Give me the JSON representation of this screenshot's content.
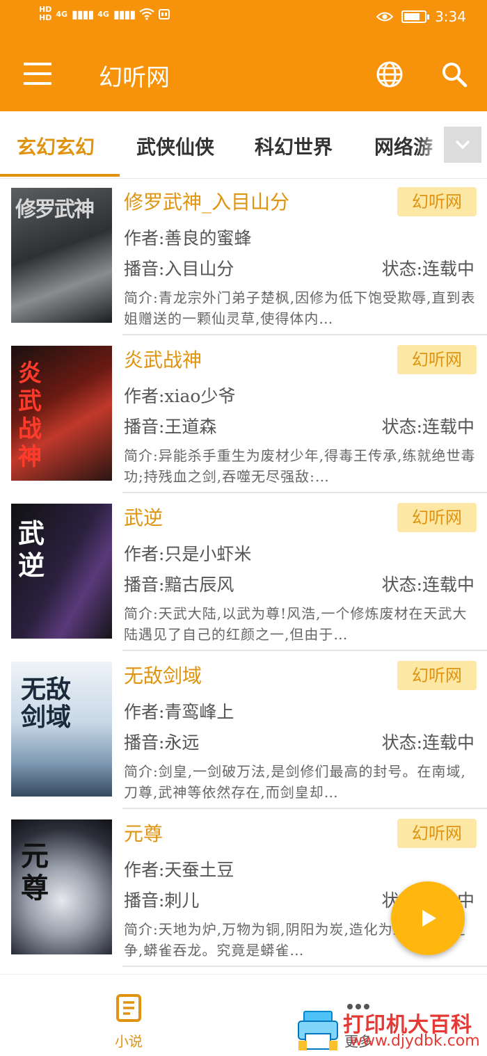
{
  "status_bar": {
    "hd_top": "HD",
    "hd_bottom": "HD",
    "net1": "4G",
    "net2": "4G",
    "time": "3:34"
  },
  "app_bar": {
    "title": "幻听网",
    "icons": [
      "menu-icon",
      "globe-icon",
      "search-icon"
    ]
  },
  "tabs": [
    {
      "label": "玄幻玄幻",
      "active": true
    },
    {
      "label": "武侠仙侠",
      "active": false
    },
    {
      "label": "科幻世界",
      "active": false
    },
    {
      "label": "网络游",
      "active": false
    }
  ],
  "books": [
    {
      "title": "修罗武神_入目山分",
      "badge": "幻听网",
      "author": "作者:善良的蜜蜂",
      "narrator": "播音:入目山分",
      "status": "状态:连载中",
      "intro": "简介:青龙宗外门弟子楚枫,因修为低下饱受欺辱,直到表姐赠送的一颗仙灵草,使得体内…",
      "cover_text": "修罗武神"
    },
    {
      "title": "炎武战神",
      "badge": "幻听网",
      "author": "作者:xiao少爷",
      "narrator": "播音:王道森",
      "status": "状态:连载中",
      "intro": "简介:异能杀手重生为废材少年,得毒王传承,练就绝世毒功;持残血之剑,吞噬无尽强敌:…",
      "cover_text": "炎武战神"
    },
    {
      "title": "武逆",
      "badge": "幻听网",
      "author": "作者:只是小虾米",
      "narrator": "播音:黯古辰风",
      "status": "状态:连载中",
      "intro": "简介:天武大陆,以武为尊!风浩,一个修炼废材在天武大陆遇见了自己的红颜之一,但由于…",
      "cover_text": "武逆"
    },
    {
      "title": "无敌剑域",
      "badge": "幻听网",
      "author": "作者:青鸾峰上",
      "narrator": "播音:永远",
      "status": "状态:连载中",
      "intro": "简介:剑皇,一剑破万法,是剑修们最高的封号。在南域,刀尊,武神等依然存在,而剑皇却…",
      "cover_text": "无敌剑域"
    },
    {
      "title": "元尊",
      "badge": "幻听网",
      "author": "作者:天蚕土豆",
      "narrator": "播音:刺儿",
      "status": "状态:连载中",
      "intro": "简介:天地为炉,万物为铜,阴阳为炭,造化为工。气运之争,蟒雀吞龙。究竟是蟒雀…",
      "cover_text": "元尊"
    }
  ],
  "bottom_nav": {
    "novel_label": "小说",
    "more_label": "更多"
  },
  "watermark": {
    "text": "打印机大百科",
    "url": "www.djydbk.com"
  },
  "colors": {
    "primary": "#F7930A",
    "accent": "#E0930E",
    "badge_bg": "#FCE7A5",
    "fab": "#FFB70F"
  }
}
